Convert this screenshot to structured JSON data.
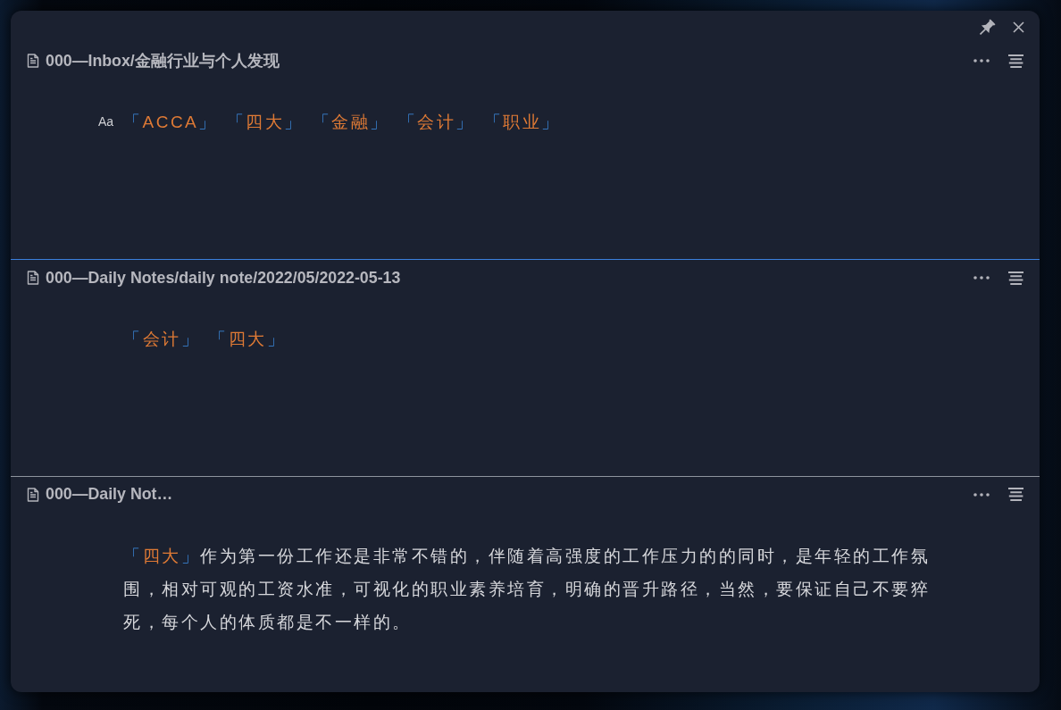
{
  "sections": [
    {
      "kind": "tags",
      "title": "000—Inbox/金融行业与个人发现",
      "focused": false,
      "prefix": "Aa",
      "tags": [
        {
          "open": "「",
          "label": "ACCA",
          "close": "」"
        },
        {
          "open": "「",
          "label": "四大",
          "close": "」"
        },
        {
          "open": "「",
          "label": "金融",
          "close": "」"
        },
        {
          "open": "「",
          "label": "会计",
          "close": "」"
        },
        {
          "open": "「",
          "label": "职业",
          "close": "」"
        }
      ]
    },
    {
      "kind": "tags",
      "title": "000—Daily Notes/daily note/2022/05/2022-05-13",
      "focused": true,
      "tags": [
        {
          "open": "「",
          "label": "会计",
          "close": "」"
        },
        {
          "open": "「",
          "label": "四大",
          "close": "」"
        }
      ]
    },
    {
      "kind": "paragraph",
      "title": "000—Daily Not…",
      "focused": false,
      "tag": {
        "open": "「",
        "label": "四大",
        "close": "」"
      },
      "text": "作为第一份工作还是非常不错的，伴随着高强度的工作压力的的同时，是年轻的工作氛围，相对可观的工资水准，可视化的职业素养培育，明确的晋升路径，当然，要保证自己不要猝死，每个人的体质都是不一样的。"
    }
  ]
}
